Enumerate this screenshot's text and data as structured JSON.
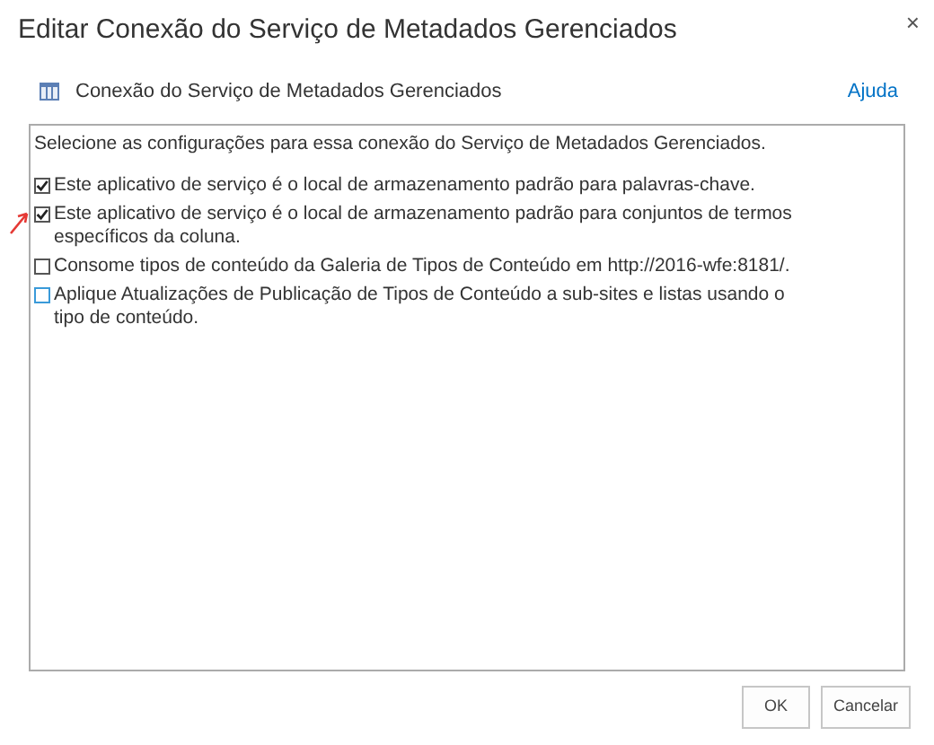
{
  "window": {
    "title": "Editar Conexão do Serviço de Metadados Gerenciados",
    "close": "×"
  },
  "header": {
    "title": "Conexão do Serviço de Metadados Gerenciados",
    "help_link": "Ajuda"
  },
  "panel": {
    "intro": "Selecione as configurações para essa conexão do Serviço de Metadados Gerenciados.",
    "options": [
      {
        "label": "Este aplicativo de serviço é o local de armazenamento padrão para palavras-chave.",
        "checked": true,
        "color": "#555555",
        "annotated": false
      },
      {
        "label": "Este aplicativo de serviço é o local de armazenamento padrão para conjuntos de termos específicos da coluna.",
        "checked": true,
        "color": "#555555",
        "annotated": true
      },
      {
        "label": "Consome tipos de conteúdo da Galeria de Tipos de Conteúdo em http://2016-wfe:8181/.",
        "checked": false,
        "color": "#555555",
        "annotated": false
      },
      {
        "label": "Aplique Atualizações de Publicação de Tipos de Conteúdo a sub-sites e listas usando o tipo de conteúdo.",
        "checked": false,
        "color": "#3a9ad9",
        "annotated": false
      }
    ]
  },
  "buttons": [
    {
      "label": "OK"
    },
    {
      "label": "Cancelar"
    }
  ]
}
